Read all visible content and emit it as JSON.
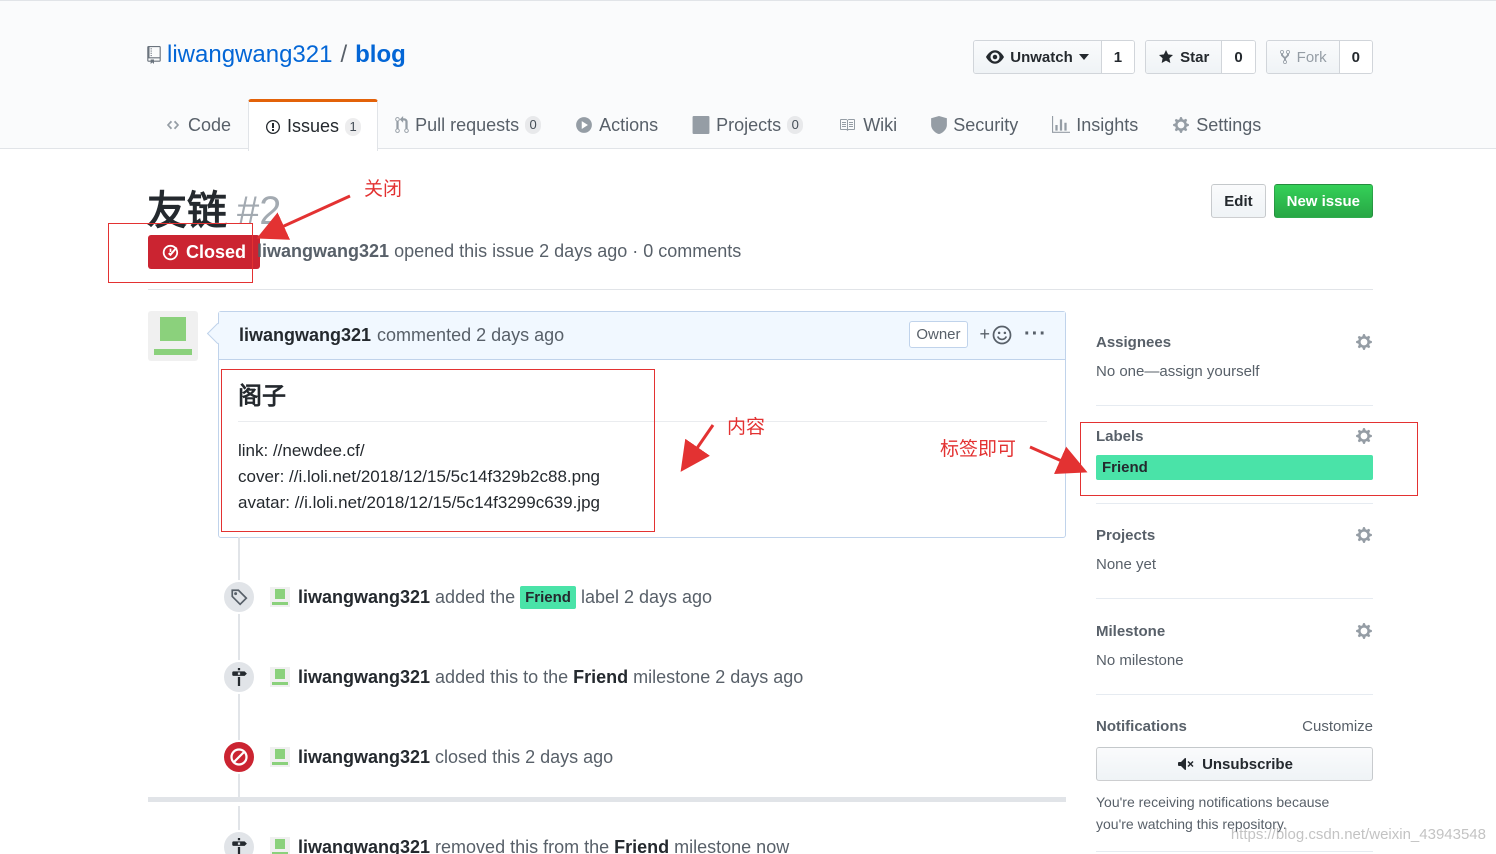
{
  "repo": {
    "owner": "liwangwang321",
    "separator": "/",
    "name": "blog"
  },
  "actions": {
    "watch": {
      "label": "Unwatch",
      "count": "1"
    },
    "star": {
      "label": "Star",
      "count": "0"
    },
    "fork": {
      "label": "Fork",
      "count": "0"
    }
  },
  "nav": {
    "code": "Code",
    "issues": "Issues",
    "issues_count": "1",
    "pulls": "Pull requests",
    "pulls_count": "0",
    "actions": "Actions",
    "projects": "Projects",
    "projects_count": "0",
    "wiki": "Wiki",
    "security": "Security",
    "insights": "Insights",
    "settings": "Settings"
  },
  "issue": {
    "title": "友链",
    "number": "#2",
    "state": "Closed",
    "author": "liwangwang321",
    "meta_rest": "opened this issue 2 days ago · 0 comments",
    "edit_label": "Edit",
    "new_issue_label": "New issue"
  },
  "comment": {
    "author": "liwangwang321",
    "time": "commented 2 days ago",
    "owner_badge": "Owner",
    "reaction": "+",
    "more": "···",
    "heading": "阁子",
    "lines": [
      "link: //newdee.cf/",
      "cover: //i.loli.net/2018/12/15/5c14f329b2c88.png",
      "avatar: //i.loli.net/2018/12/15/5c14f3299c639.jpg"
    ]
  },
  "events": [
    {
      "author": "liwangwang321",
      "pre": "added the",
      "label": "Friend",
      "post": "label 2 days ago"
    },
    {
      "author": "liwangwang321",
      "pre": "added this to the",
      "strong": "Friend",
      "post": "milestone 2 days ago"
    },
    {
      "author": "liwangwang321",
      "pre": "closed this 2 days ago"
    },
    {
      "author": "liwangwang321",
      "pre": "removed this from the",
      "strong": "Friend",
      "post": "milestone now"
    }
  ],
  "sidebar": {
    "assignees": {
      "heading": "Assignees",
      "value": "No one—assign yourself"
    },
    "labels": {
      "heading": "Labels",
      "value": "Friend"
    },
    "projects": {
      "heading": "Projects",
      "value": "None yet"
    },
    "milestone": {
      "heading": "Milestone",
      "value": "No milestone"
    },
    "notifications": {
      "heading": "Notifications",
      "customize": "Customize",
      "button": "Unsubscribe",
      "note_1": "You're receiving notifications because",
      "note_2": "you're watching this repository."
    }
  },
  "annotations": {
    "close": "关闭",
    "content": "内容",
    "labels": "标签即可"
  },
  "watermark": "https://blog.csdn.net/weixin_43943548",
  "colors": {
    "closed": "#cb2431",
    "friend_label": "#4ae3a8",
    "link": "#0366d6",
    "annotation": "#e33232",
    "new_issue": "#28a745"
  }
}
